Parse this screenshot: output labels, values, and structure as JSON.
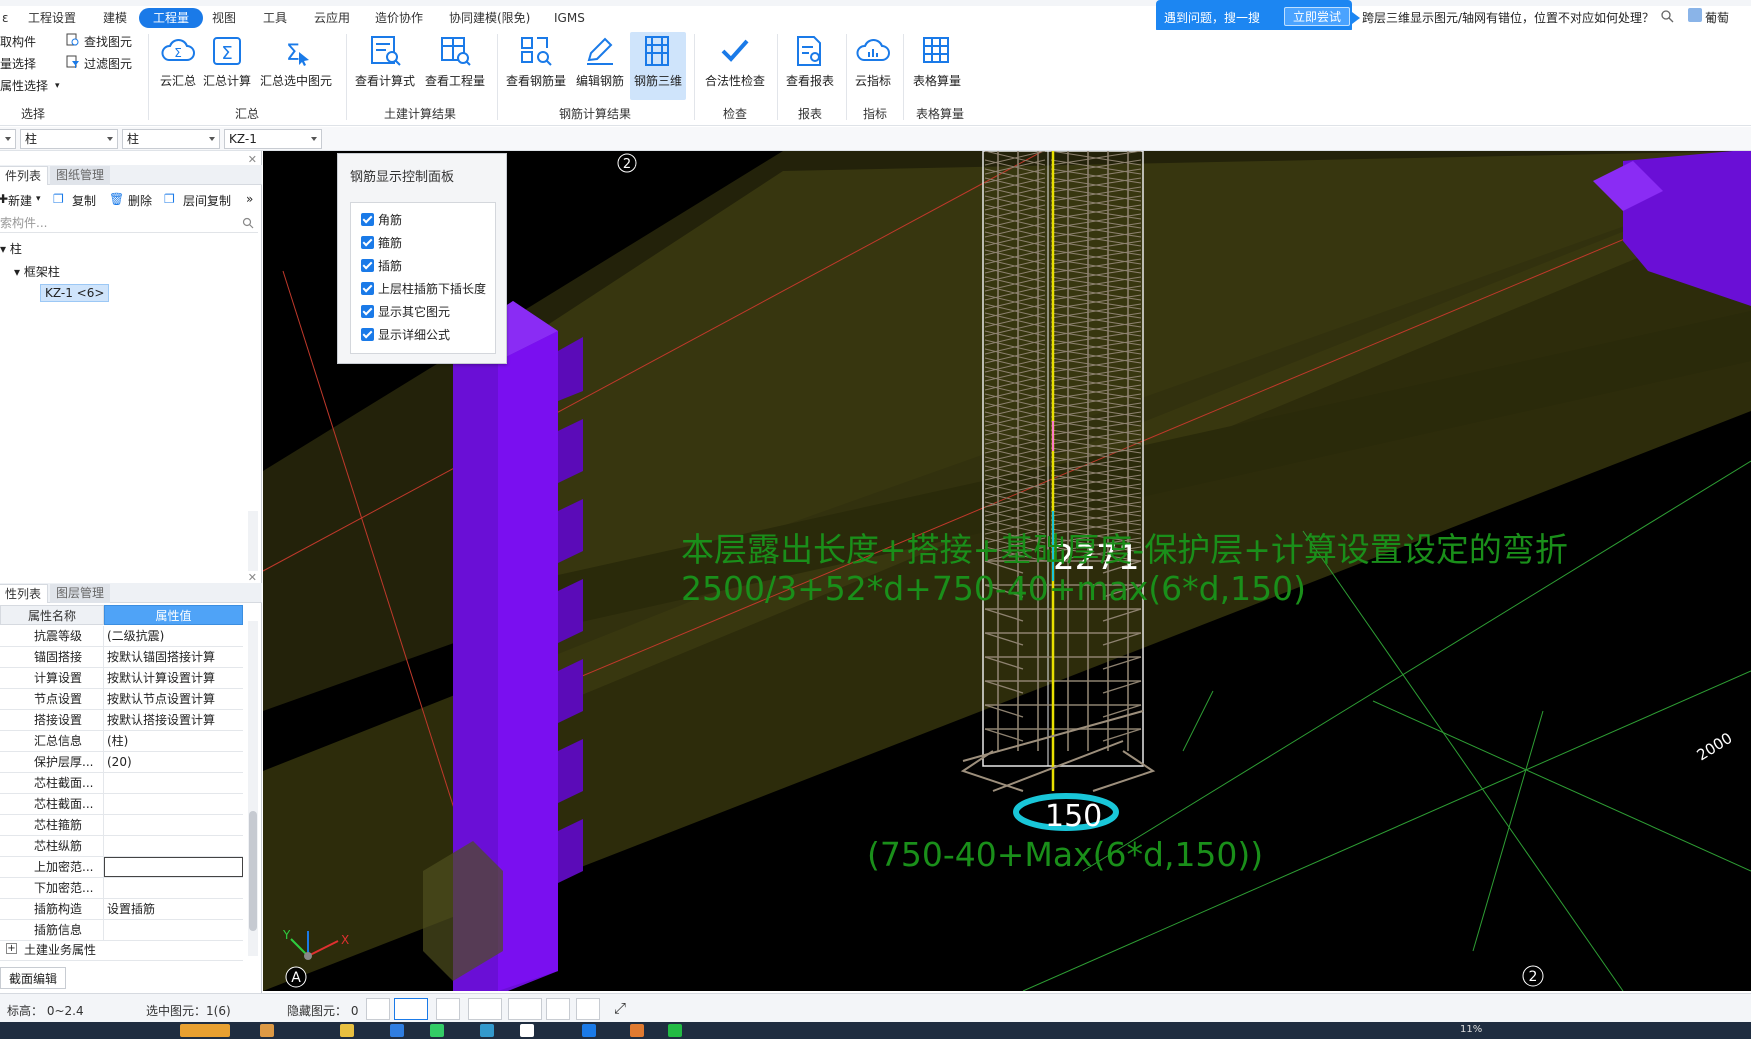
{
  "menu": {
    "items": [
      "工程设置",
      "建模",
      "工程量",
      "视图",
      "工具",
      "云应用",
      "造价协作",
      "协同建模(限免)",
      "IGMS"
    ],
    "active": "工程量"
  },
  "help": {
    "prompt": "遇到问题，搜一搜",
    "try_button": "立即尝试",
    "query": "跨层三维显示图元/轴网有错位，位置不对应如何处理？",
    "user": "葡萄"
  },
  "ribbon": {
    "select_group": {
      "items": [
        "取构件",
        "量选择",
        "属性选择"
      ],
      "right_items": [
        "查找图元",
        "过滤图元"
      ],
      "label": "选择"
    },
    "sum_group": {
      "buttons": [
        "云汇总",
        "汇总计算",
        "汇总选中图元"
      ],
      "label": "汇总"
    },
    "civil_group": {
      "buttons": [
        "查看计算式",
        "查看工程量"
      ],
      "label": "土建计算结果"
    },
    "rebar_group": {
      "buttons": [
        "查看钢筋量",
        "编辑钢筋",
        "钢筋三维"
      ],
      "label": "钢筋计算结果",
      "selected": "钢筋三维"
    },
    "check_group": {
      "buttons": [
        "合法性检查"
      ],
      "label": "检查"
    },
    "report_group": {
      "buttons": [
        "查看报表"
      ],
      "label": "报表"
    },
    "index_group": {
      "buttons": [
        "云指标"
      ],
      "label": "指标"
    },
    "table_group": {
      "buttons": [
        "表格算量"
      ],
      "label": "表格算量"
    }
  },
  "filter": {
    "combo1": "柱",
    "combo2": "柱",
    "combo3": "KZ-1"
  },
  "component_panel": {
    "tabs": [
      "件列表",
      "图纸管理"
    ],
    "toolbar": [
      "新建",
      "复制",
      "删除",
      "层间复制"
    ],
    "search_placeholder": "索构件...",
    "tree": {
      "root": "柱",
      "child": "框架柱",
      "leaf": "KZ-1 <6>"
    }
  },
  "property_panel": {
    "tabs": [
      "性列表",
      "图层管理"
    ],
    "headers": [
      "属性名称",
      "属性值"
    ],
    "rows": [
      {
        "name": "抗震等级",
        "value": "(二级抗震)"
      },
      {
        "name": "锚固搭接",
        "value": "按默认锚固搭接计算"
      },
      {
        "name": "计算设置",
        "value": "按默认计算设置计算"
      },
      {
        "name": "节点设置",
        "value": "按默认节点设置计算"
      },
      {
        "name": "搭接设置",
        "value": "按默认搭接设置计算"
      },
      {
        "name": "汇总信息",
        "value": "(柱)"
      },
      {
        "name": "保护层厚...",
        "value": "(20)"
      },
      {
        "name": "芯柱截面...",
        "value": ""
      },
      {
        "name": "芯柱截面...",
        "value": ""
      },
      {
        "name": "芯柱箍筋",
        "value": ""
      },
      {
        "name": "芯柱纵筋",
        "value": ""
      },
      {
        "name": "上加密范...",
        "value": ""
      },
      {
        "name": "下加密范...",
        "value": ""
      },
      {
        "name": "插筋构造",
        "value": "设置插筋"
      },
      {
        "name": "插筋信息",
        "value": ""
      }
    ],
    "group_row": "土建业务属性",
    "bottom_tab": "截面编辑"
  },
  "control_panel": {
    "title": "钢筋显示控制面板",
    "options": [
      "角筋",
      "箍筋",
      "插筋",
      "上层柱插筋下插长度",
      "显示其它图元",
      "显示详细公式"
    ]
  },
  "viewport": {
    "grid_labels": {
      "top": "2",
      "bottom_right": "2",
      "bottom_left": "A"
    },
    "dimension_top": "2271",
    "dimension_bottom": "150",
    "formula_title": "本层露出长度+搭接+基础厚度-保护层+计算设置设定的弯折",
    "formula_expr": "2500/3+52*d+750-40+max(6*d,150)",
    "formula_bottom": "(750-40+Max(6*d,150))",
    "edge_label": "2000",
    "axis_x": "X",
    "axis_y": "Y",
    "colors": {
      "column": "#7a0ff0",
      "beam": "#3b3a0f",
      "formula": "#1a8f1a",
      "ring": "#19c6d8"
    }
  },
  "status": {
    "elevation": "标高：  0~2.4",
    "selected": "选中图元：1(6)",
    "hidden": "隐藏图元：  0"
  },
  "taskbar": {
    "right_text": "11%"
  }
}
